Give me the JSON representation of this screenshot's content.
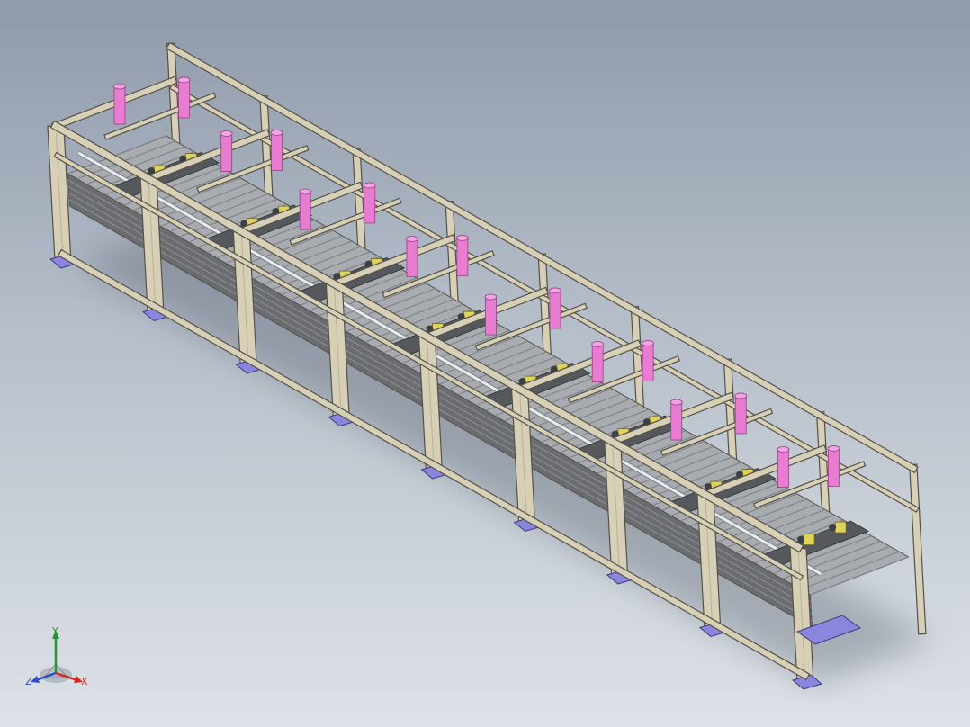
{
  "viewport": {
    "background_top": "#8f9aaa",
    "background_bottom": "#dde2e7"
  },
  "model": {
    "modules": 8,
    "colors": {
      "frame_face": "#d7d0b6",
      "frame_edge": "#545149",
      "conveyor_dark": "#6a6c70",
      "conveyor_light": "#a8acb0",
      "cylinder": "#e77cd0",
      "cylinder_top": "#f0a5e3",
      "foot_plate": "#8a86de",
      "motor": "#ddd25a",
      "shaft": "#e8ecef"
    }
  },
  "triad": {
    "x_label": "X",
    "y_label": "Y",
    "z_label": "Z",
    "x_color": "#d4271f",
    "y_color": "#1c9a2a",
    "z_color": "#2d4fc4"
  }
}
